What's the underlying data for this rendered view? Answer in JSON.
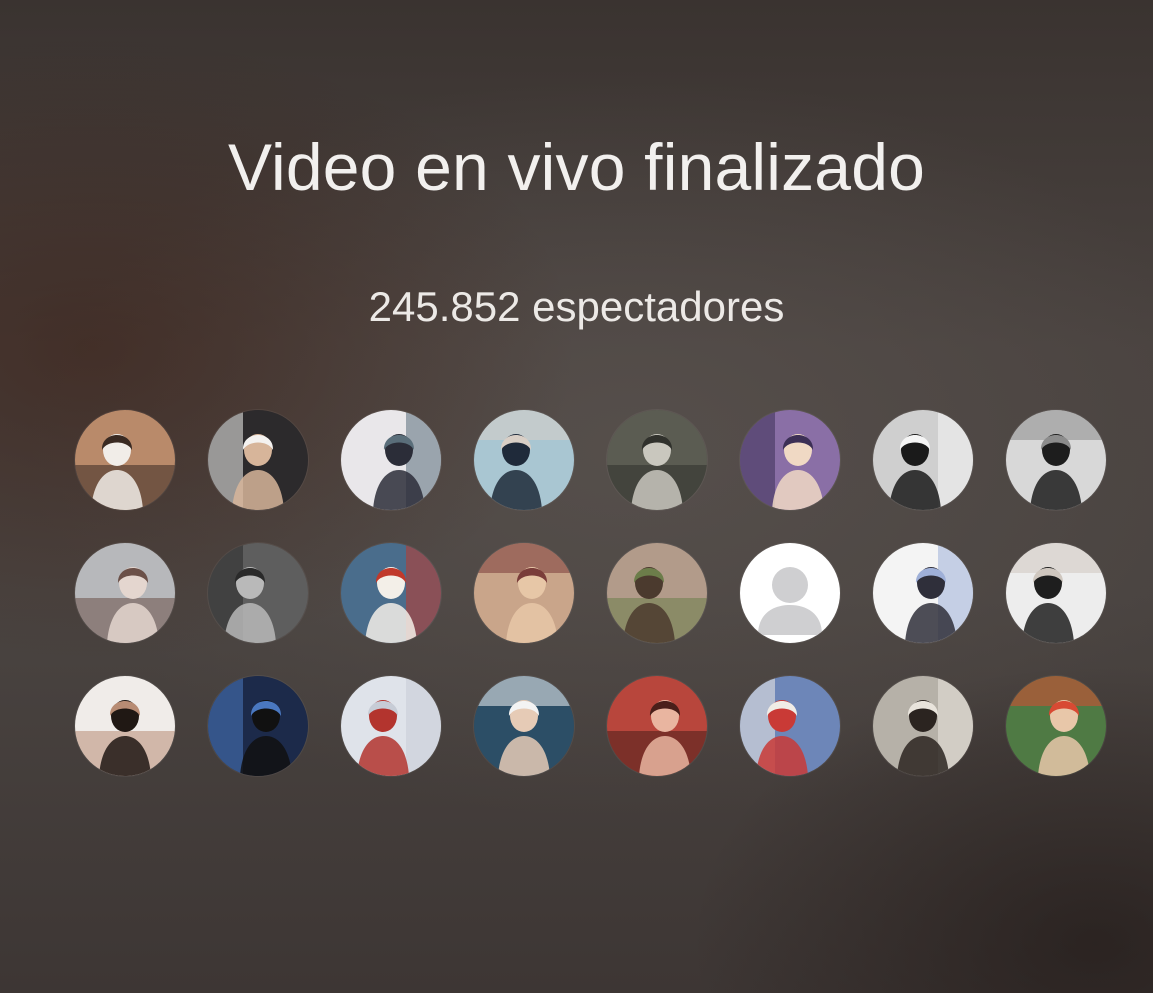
{
  "title": "Video en vivo finalizado",
  "viewers_text": "245.852 espectadores",
  "avatars": [
    {
      "icon": "photo-icon",
      "bg": "#b98a6a",
      "fg": "#f1ede8",
      "accent": "#3a2a22"
    },
    {
      "icon": "photo-icon",
      "bg": "#2c2a2c",
      "fg": "#d7b59a",
      "accent": "#f4f2f0"
    },
    {
      "icon": "photo-icon",
      "bg": "#e9e7ea",
      "fg": "#2b2d38",
      "accent": "#5a6e7a"
    },
    {
      "icon": "photo-icon",
      "bg": "#a9c6d2",
      "fg": "#1f2a3a",
      "accent": "#d9cfc6"
    },
    {
      "icon": "photo-icon",
      "bg": "#5b5c52",
      "fg": "#c9c7be",
      "accent": "#30312c"
    },
    {
      "icon": "photo-icon",
      "bg": "#8a6fa6",
      "fg": "#f0d9c4",
      "accent": "#3c2f55"
    },
    {
      "icon": "photo-icon",
      "bg": "#cfcfcf",
      "fg": "#1a1a1a",
      "accent": "#f5f5f5"
    },
    {
      "icon": "photo-icon",
      "bg": "#d8d8d8",
      "fg": "#1d1d1d",
      "accent": "#8c8c8c"
    },
    {
      "icon": "photo-icon",
      "bg": "#b7b8bb",
      "fg": "#e4d6cf",
      "accent": "#6b5048"
    },
    {
      "icon": "photo-icon",
      "bg": "#5e5e5e",
      "fg": "#b9b9b9",
      "accent": "#2a2a2a"
    },
    {
      "icon": "photo-icon",
      "bg": "#4a6d8c",
      "fg": "#f3efe8",
      "accent": "#c0392b"
    },
    {
      "icon": "photo-icon",
      "bg": "#c9a58a",
      "fg": "#e7c7a7",
      "accent": "#7a3d3a"
    },
    {
      "icon": "photo-icon",
      "bg": "#b29b8a",
      "fg": "#4b3a2e",
      "accent": "#6c7d4a"
    },
    {
      "icon": "default-avatar-icon",
      "bg": "#ffffff",
      "fg": "#cfcfd1",
      "accent": "#e9e9ea"
    },
    {
      "icon": "photo-icon",
      "bg": "#f4f4f4",
      "fg": "#2f2f3a",
      "accent": "#9fb0d8"
    },
    {
      "icon": "photo-icon",
      "bg": "#ededed",
      "fg": "#1e1e1e",
      "accent": "#cfc7bf"
    },
    {
      "icon": "photo-icon",
      "bg": "#f0ece9",
      "fg": "#201814",
      "accent": "#b88c74"
    },
    {
      "icon": "photo-icon",
      "bg": "#1c2a4a",
      "fg": "#111111",
      "accent": "#4a78c0"
    },
    {
      "icon": "photo-icon",
      "bg": "#dfe3ea",
      "fg": "#b3342e",
      "accent": "#c7ccd6"
    },
    {
      "icon": "photo-icon",
      "bg": "#2c4e66",
      "fg": "#e6cbb6",
      "accent": "#f3f3f3"
    },
    {
      "icon": "photo-icon",
      "bg": "#b8463c",
      "fg": "#e9b5a0",
      "accent": "#4a1f1a"
    },
    {
      "icon": "photo-icon",
      "bg": "#6d86b8",
      "fg": "#c93a36",
      "accent": "#f0ece6"
    },
    {
      "icon": "photo-icon",
      "bg": "#b6b1a8",
      "fg": "#2b2420",
      "accent": "#e9e4dc"
    },
    {
      "icon": "photo-icon",
      "bg": "#4f7a44",
      "fg": "#e8c7a9",
      "accent": "#d84a33"
    }
  ]
}
